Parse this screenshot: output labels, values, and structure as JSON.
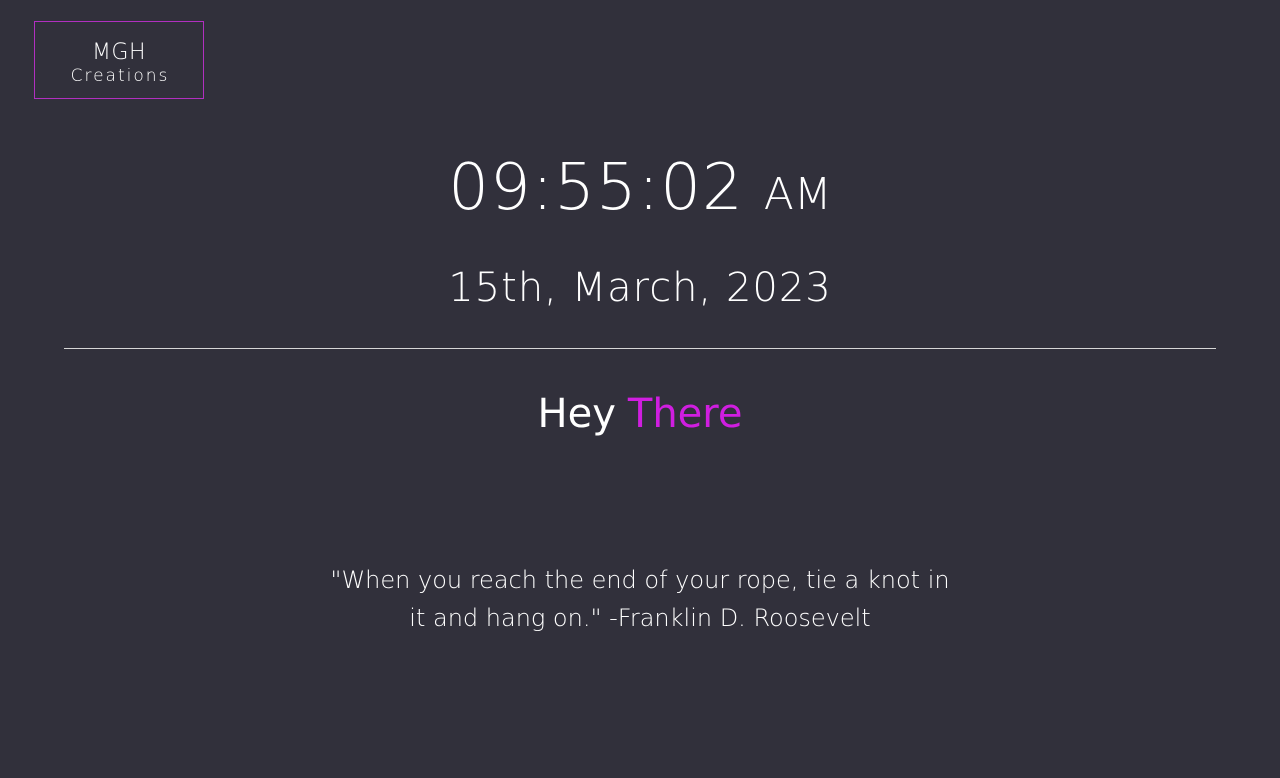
{
  "logo": {
    "main": "MGH",
    "sub": "Creations"
  },
  "clock": {
    "time": "09:55:02",
    "ampm": "AM"
  },
  "date": "15th, March, 2023",
  "greeting": {
    "word1": "Hey",
    "word2": "There"
  },
  "quote": "\"When you reach the end of your rope, tie a knot in it and hang on.\" -Franklin D. Roosevelt",
  "colors": {
    "background": "#31303b",
    "accent": "#d01ee0",
    "logo_border": "#b12fc0",
    "text": "#ffffff"
  }
}
